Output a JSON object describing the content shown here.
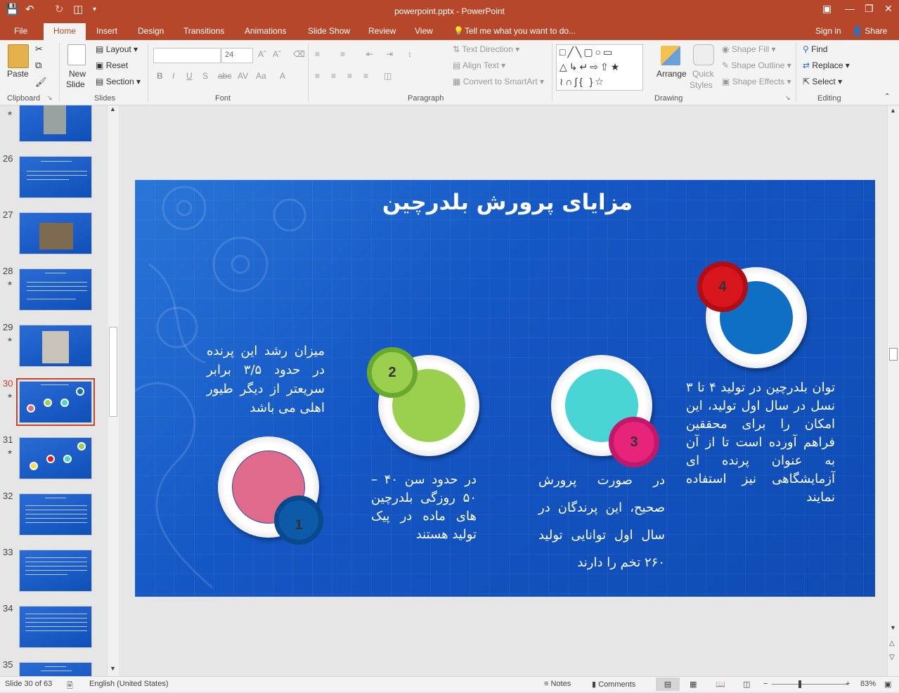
{
  "app": {
    "window_title": "powerpoint.pptx - PowerPoint",
    "sign_in": "Sign in",
    "share": "Share"
  },
  "tabs": [
    {
      "label": "File"
    },
    {
      "label": "Home"
    },
    {
      "label": "Insert"
    },
    {
      "label": "Design"
    },
    {
      "label": "Transitions"
    },
    {
      "label": "Animations"
    },
    {
      "label": "Slide Show"
    },
    {
      "label": "Review"
    },
    {
      "label": "View"
    }
  ],
  "tell_me": "Tell me what you want to do...",
  "ribbon": {
    "clipboard": {
      "paste": "Paste",
      "label": "Clipboard"
    },
    "slides": {
      "new_slide": "New",
      "new_slide2": "Slide",
      "layout": "Layout",
      "reset": "Reset",
      "section": "Section",
      "label": "Slides"
    },
    "font": {
      "size": "24",
      "label": "Font"
    },
    "paragraph": {
      "text_direction": "Text Direction",
      "align_text": "Align Text",
      "smartart": "Convert to SmartArt",
      "label": "Paragraph"
    },
    "drawing": {
      "arrange": "Arrange",
      "quick_styles": "Quick",
      "quick_styles2": "Styles",
      "shape_fill": "Shape Fill",
      "shape_outline": "Shape Outline",
      "shape_effects": "Shape Effects",
      "label": "Drawing"
    },
    "editing": {
      "find": "Find",
      "replace": "Replace",
      "select": "Select",
      "label": "Editing"
    }
  },
  "thumbnails": [
    {
      "num": "26"
    },
    {
      "num": "27"
    },
    {
      "num": "28"
    },
    {
      "num": "29"
    },
    {
      "num": "30"
    },
    {
      "num": "31"
    },
    {
      "num": "32"
    },
    {
      "num": "33"
    },
    {
      "num": "34"
    },
    {
      "num": "35"
    }
  ],
  "slide": {
    "title": "مزایای پرورش بلدرچین",
    "items": [
      {
        "num": "1",
        "text": "میزان رشد این پرنده در حدود ۳/۵ برابر سریعتر از دیگر طیور اهلی می باشد",
        "color": "#e06a8c",
        "badge": "#0d5aa8"
      },
      {
        "num": "2",
        "text": "در حدود سن ۴۰ – ۵۰ روزگی بلدرچین های ماده در پیک تولید هستند",
        "color": "#9ad04e",
        "badge": "#6aa82e"
      },
      {
        "num": "3",
        "text": "در صورت پرورش صحیح، این پرندگان در سال اول توانایی تولید ۲۶۰ تخم را دارند",
        "color": "#48d3d4",
        "badge": "#e8237a"
      },
      {
        "num": "4",
        "text": "توان بلدرچین در تولید ۴ تا ۳ نسل در سال اول تولید، این امکان را برای محققین فراهم آورده است تا از آن به عنوان پرنده ای آزمایشگاهی نیز استفاده نمایند",
        "color": "#0f6fc4",
        "badge": "#d8141c"
      }
    ]
  },
  "status": {
    "slide_info": "Slide 30 of 63",
    "language": "English (United States)",
    "notes": "Notes",
    "comments": "Comments",
    "zoom": "83%"
  }
}
